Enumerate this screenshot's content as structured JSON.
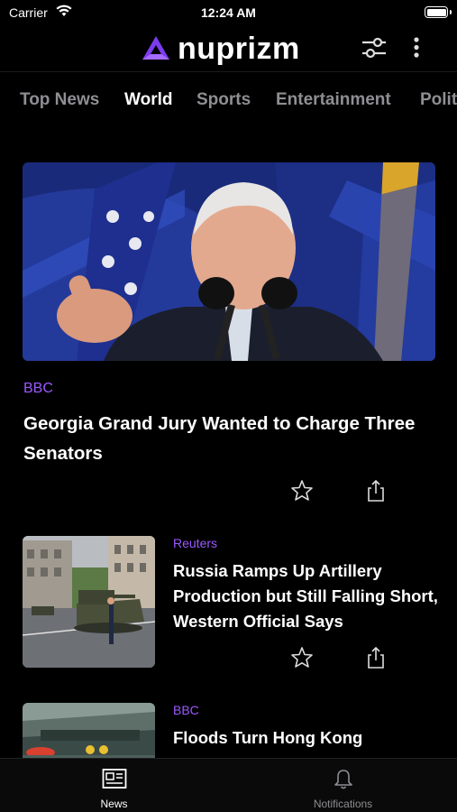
{
  "status_bar": {
    "carrier": "Carrier",
    "time": "12:24 AM"
  },
  "header": {
    "app_name": "nuprizm",
    "brand_color": "#7b3cf0"
  },
  "tabs": [
    {
      "label": "Top News",
      "active": false
    },
    {
      "label": "World",
      "active": true
    },
    {
      "label": "Sports",
      "active": false
    },
    {
      "label": "Entertainment",
      "active": false
    },
    {
      "label": "Politics",
      "active": false
    }
  ],
  "featured": {
    "source": "BBC",
    "title": "Georgia Grand Jury Wanted to Charge Three Senators",
    "image": "photo of senator speaking at podium with flags"
  },
  "articles": [
    {
      "source": "Reuters",
      "title": "Russia Ramps Up Artillery Production but Still Falling Short, Western Official Says",
      "image": "destroyed tanks displayed on city street"
    },
    {
      "source": "BBC",
      "title": "Floods Turn Hong Kong",
      "image": "flooded street at night"
    }
  ],
  "bottom_tabs": [
    {
      "label": "News",
      "icon": "newspaper-icon",
      "active": true
    },
    {
      "label": "Notifications",
      "icon": "bell-icon",
      "active": false
    }
  ],
  "colors": {
    "accent": "#9b59ff",
    "inactive": "#8e8e93",
    "background": "#000000"
  }
}
